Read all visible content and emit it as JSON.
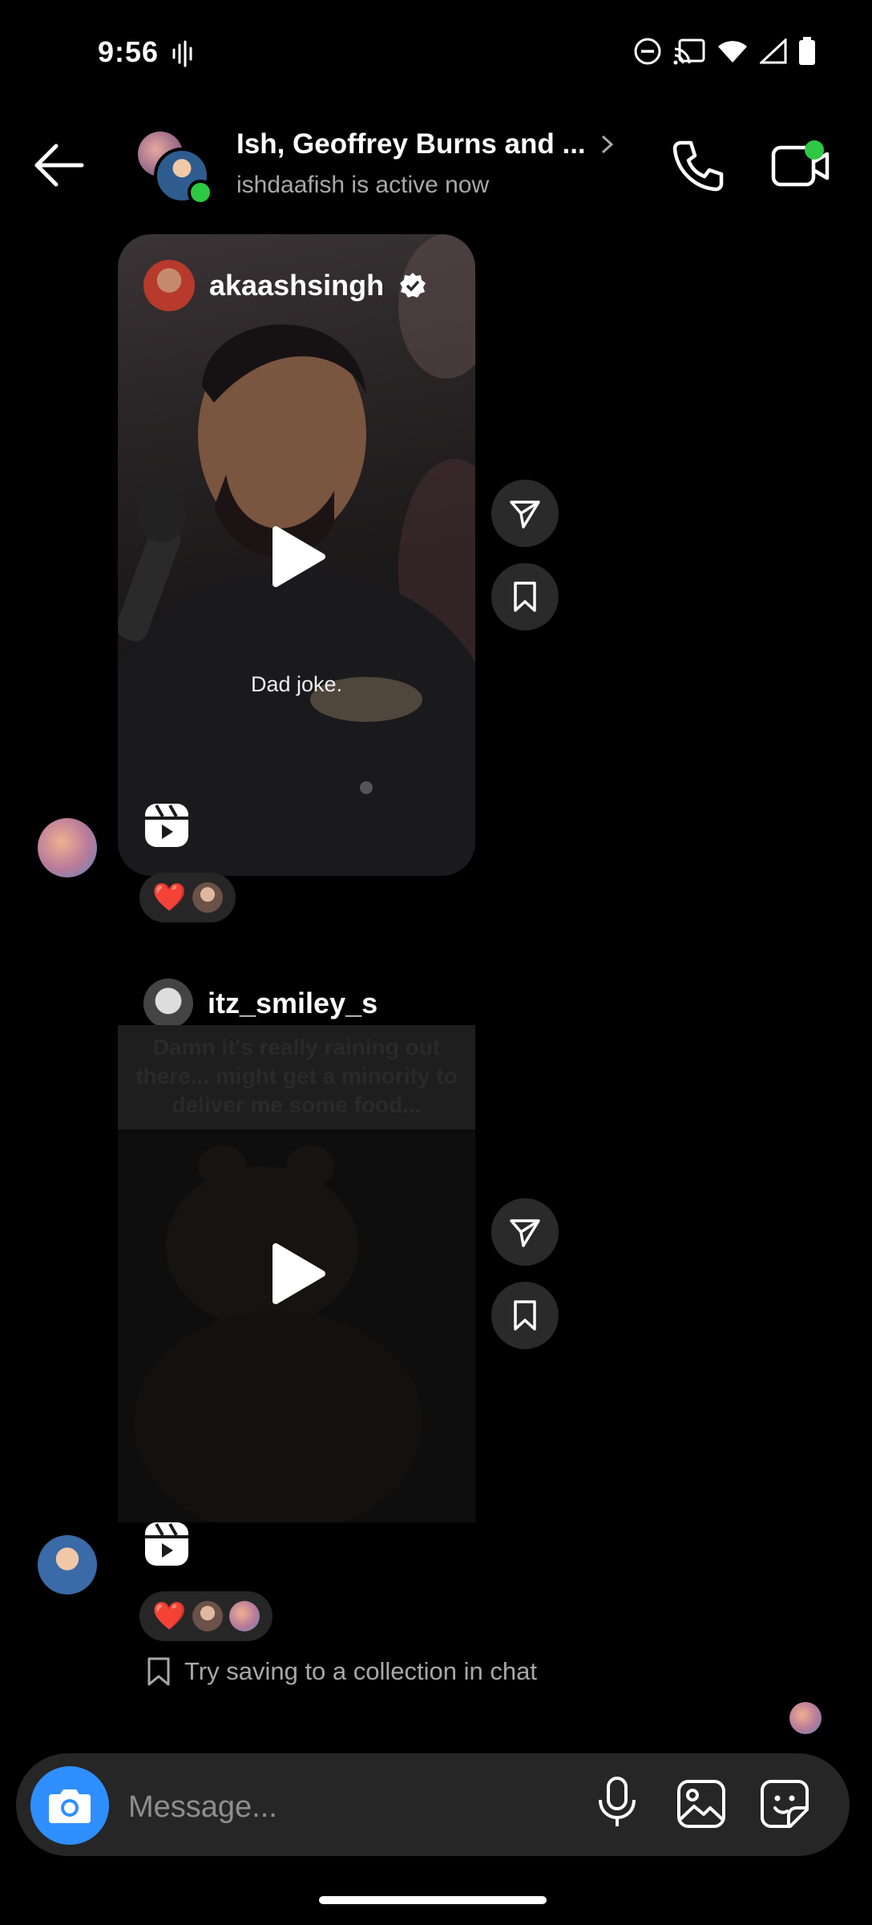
{
  "status_bar": {
    "time": "9:56"
  },
  "header": {
    "title": "Ish, Geoffrey Burns and ...",
    "subtitle": "ishdaafish is active now"
  },
  "messages": [
    {
      "username": "akaashsingh",
      "verified": true,
      "caption": "Dad joke.",
      "reactions": [
        "❤️"
      ]
    },
    {
      "username": "itz_smiley_s",
      "overlay_text": "Damn it's really raining out there... might get a minority to deliver me some food...",
      "reactions": [
        "❤️"
      ]
    }
  ],
  "tip": "Try saving to a collection in chat",
  "composer": {
    "placeholder": "Message..."
  },
  "colors": {
    "accent": "#2f8fff",
    "online": "#2ec844"
  }
}
